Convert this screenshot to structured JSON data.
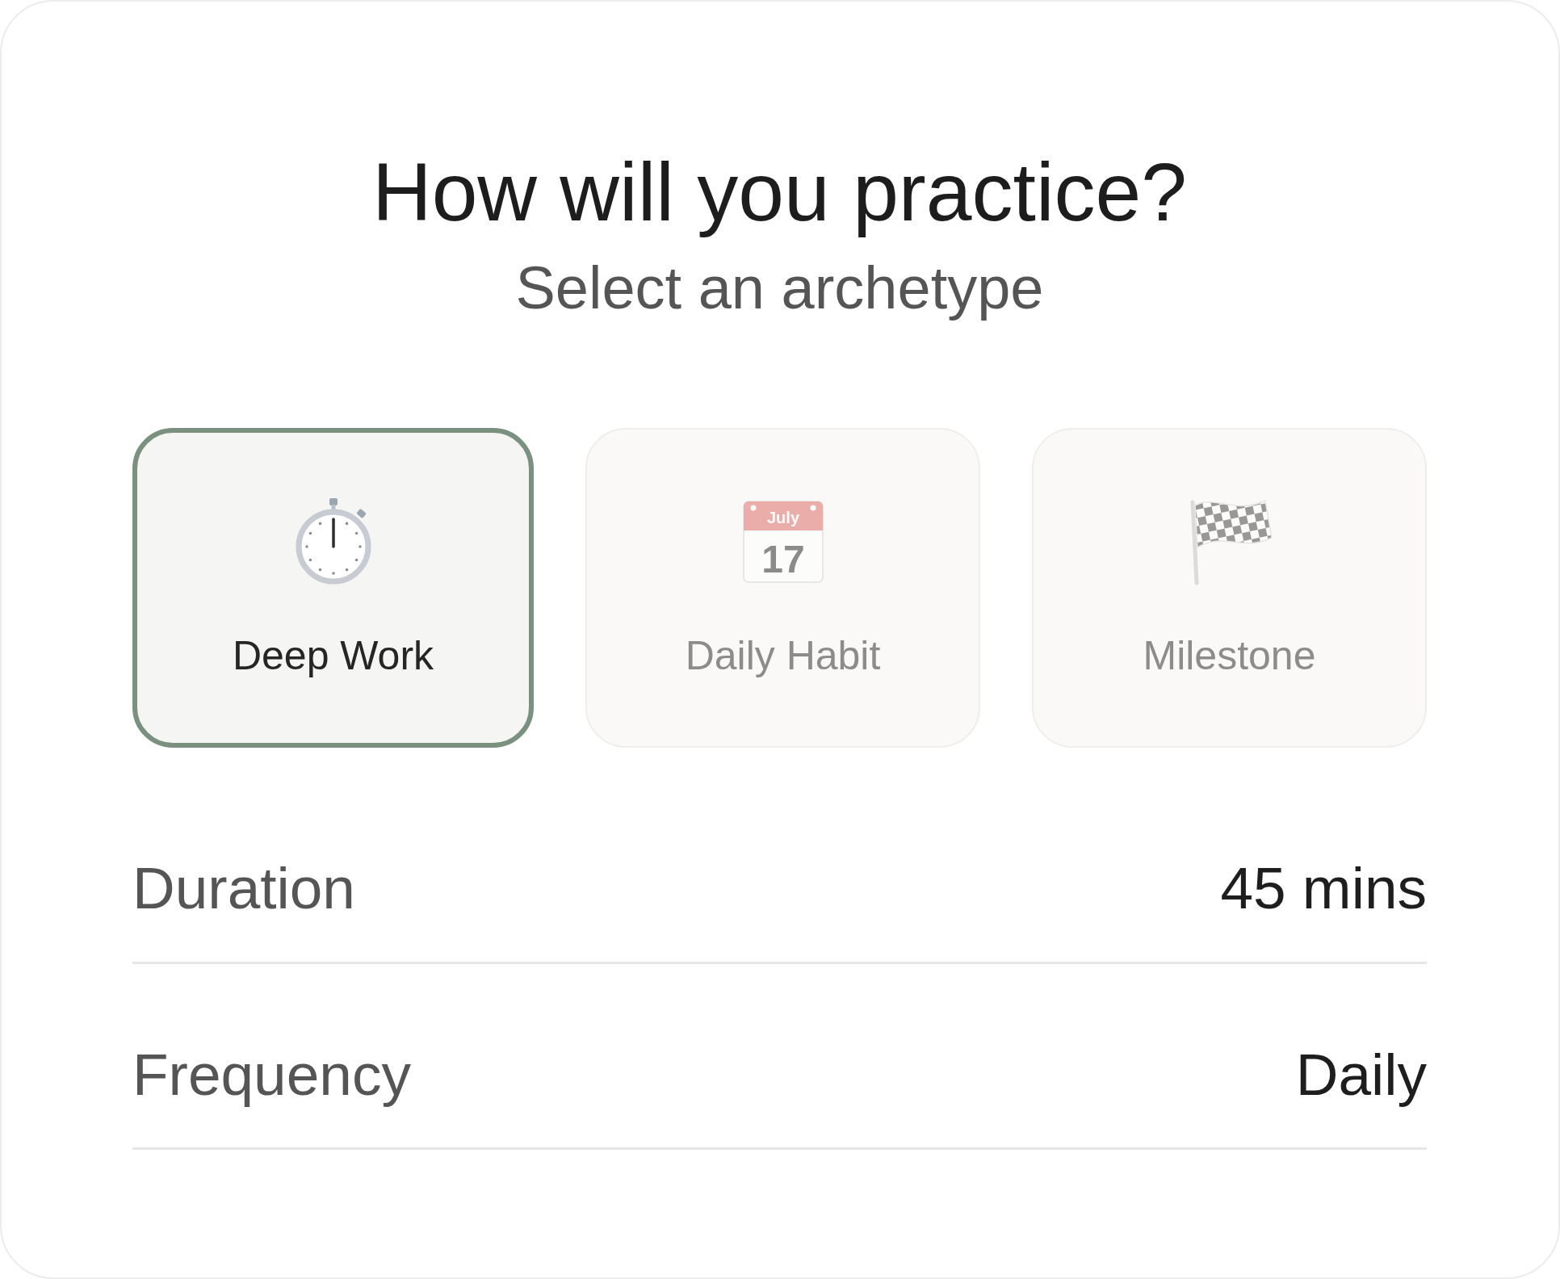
{
  "title": "How will you practice?",
  "subtitle": "Select an archetype",
  "archetypes": [
    {
      "kind": "stopwatch",
      "label": "Deep Work",
      "selected": true
    },
    {
      "kind": "calendar",
      "label": "Daily Habit",
      "selected": false,
      "calendar_month": "July",
      "calendar_day": "17"
    },
    {
      "kind": "flag",
      "label": "Milestone",
      "selected": false
    }
  ],
  "settings": [
    {
      "label": "Duration",
      "value": "45 mins"
    },
    {
      "label": "Frequency",
      "value": "Daily"
    }
  ]
}
